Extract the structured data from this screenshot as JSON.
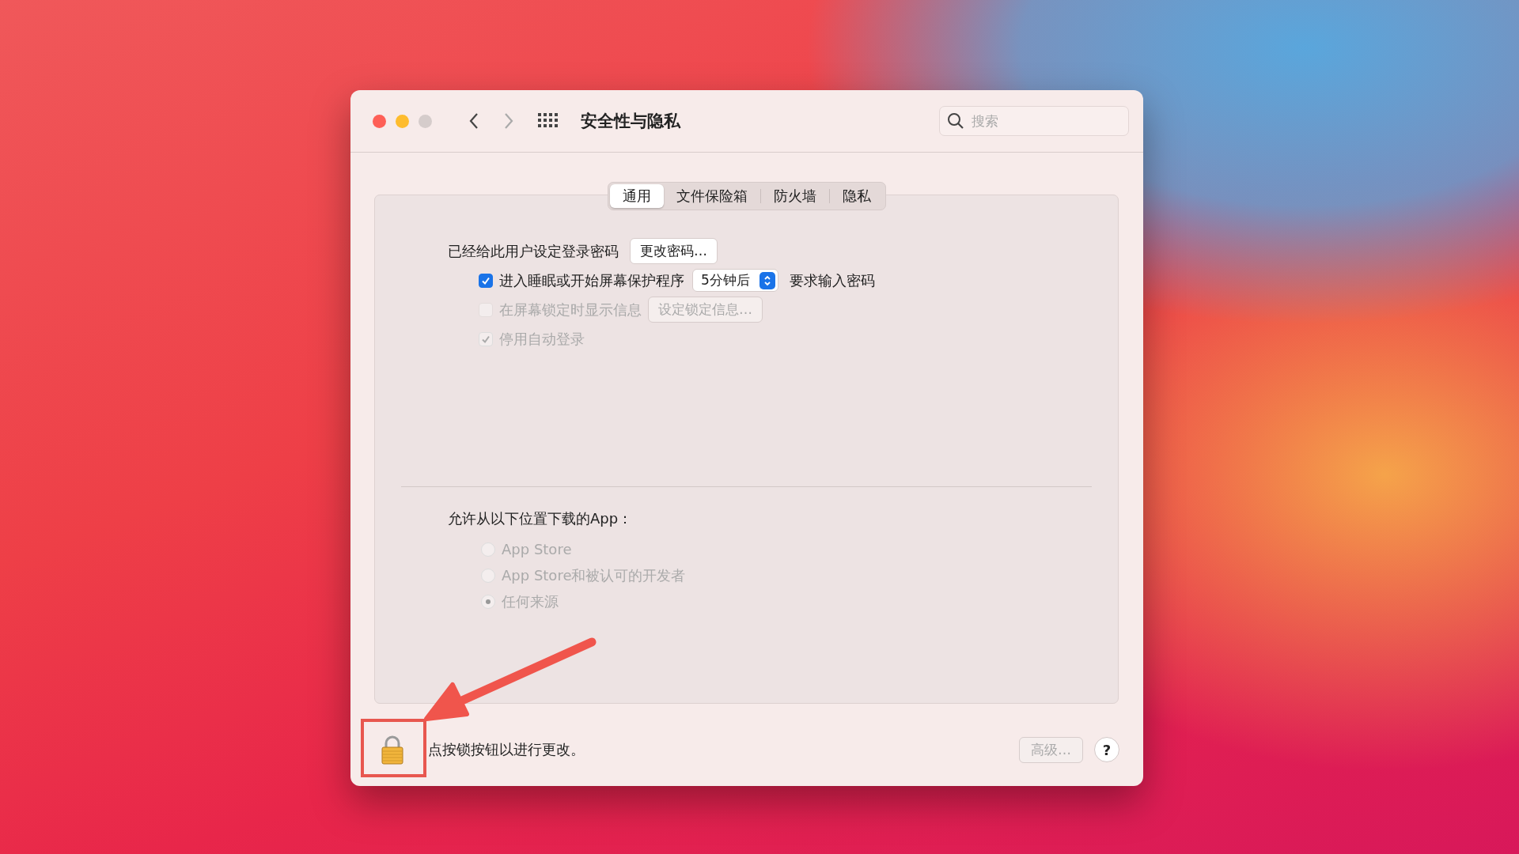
{
  "window": {
    "title": "安全性与隐私",
    "search": {
      "placeholder": "搜索"
    }
  },
  "tabs": [
    {
      "label": "通用",
      "selected": true
    },
    {
      "label": "文件保险箱",
      "selected": false
    },
    {
      "label": "防火墙",
      "selected": false
    },
    {
      "label": "隐私",
      "selected": false
    }
  ],
  "general": {
    "password_label": "已经给此用户设定登录密码",
    "change_password_button": "更改密码…",
    "options": [
      {
        "kind": "checkbox-popup",
        "label": "进入睡眠或开始屏幕保护程序",
        "checked": true,
        "disabled": false,
        "popup": "5分钟后",
        "suffix": "要求输入密码"
      },
      {
        "kind": "checkbox-button",
        "label": "在屏幕锁定时显示信息",
        "checked": false,
        "disabled": true,
        "button": "设定锁定信息…"
      },
      {
        "kind": "checkbox",
        "label": "停用自动登录",
        "checked": true,
        "disabled": true
      }
    ]
  },
  "downloads": {
    "label": "允许从以下位置下载的App：",
    "options": [
      {
        "label": "App Store",
        "selected": false,
        "disabled": true
      },
      {
        "label": "App Store和被认可的开发者",
        "selected": false,
        "disabled": true
      },
      {
        "label": "任何来源",
        "selected": true,
        "disabled": true
      }
    ]
  },
  "footer": {
    "lock_text": "点按锁按钮以进行更改。",
    "advanced_button": "高级…",
    "advanced_disabled": true,
    "help_button": "?"
  }
}
